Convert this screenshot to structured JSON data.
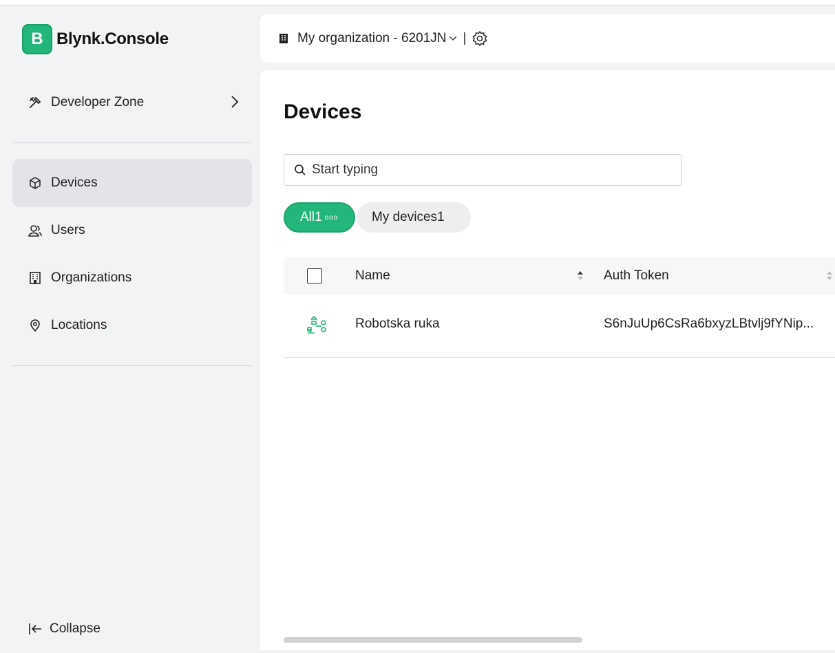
{
  "app": {
    "logo_letter": "B",
    "logo_text": "Blynk.Console",
    "brand_color": "#23b67a"
  },
  "sidebar": {
    "developer_zone": {
      "label": "Developer Zone",
      "icon": "tools-icon"
    },
    "items": [
      {
        "label": "Devices",
        "icon": "cube-icon",
        "active": true
      },
      {
        "label": "Users",
        "icon": "users-icon",
        "active": false
      },
      {
        "label": "Organizations",
        "icon": "building-icon",
        "active": false
      },
      {
        "label": "Locations",
        "icon": "location-pin-icon",
        "active": false
      }
    ],
    "collapse_label": "Collapse"
  },
  "header": {
    "org_label": "My organization - 6201JN",
    "separator": "|"
  },
  "main": {
    "title": "Devices",
    "search": {
      "placeholder": "Start typing",
      "value": ""
    },
    "filters": {
      "all_label": "All1",
      "all_dots": "ooo",
      "my_label": "My devices1"
    },
    "table": {
      "columns": [
        "Name",
        "Auth Token"
      ],
      "rows": [
        {
          "name": "Robotska ruka",
          "auth_token": "S6nJuUp6CsRa6bxyzLBtvlj9fYNip..."
        }
      ]
    }
  }
}
